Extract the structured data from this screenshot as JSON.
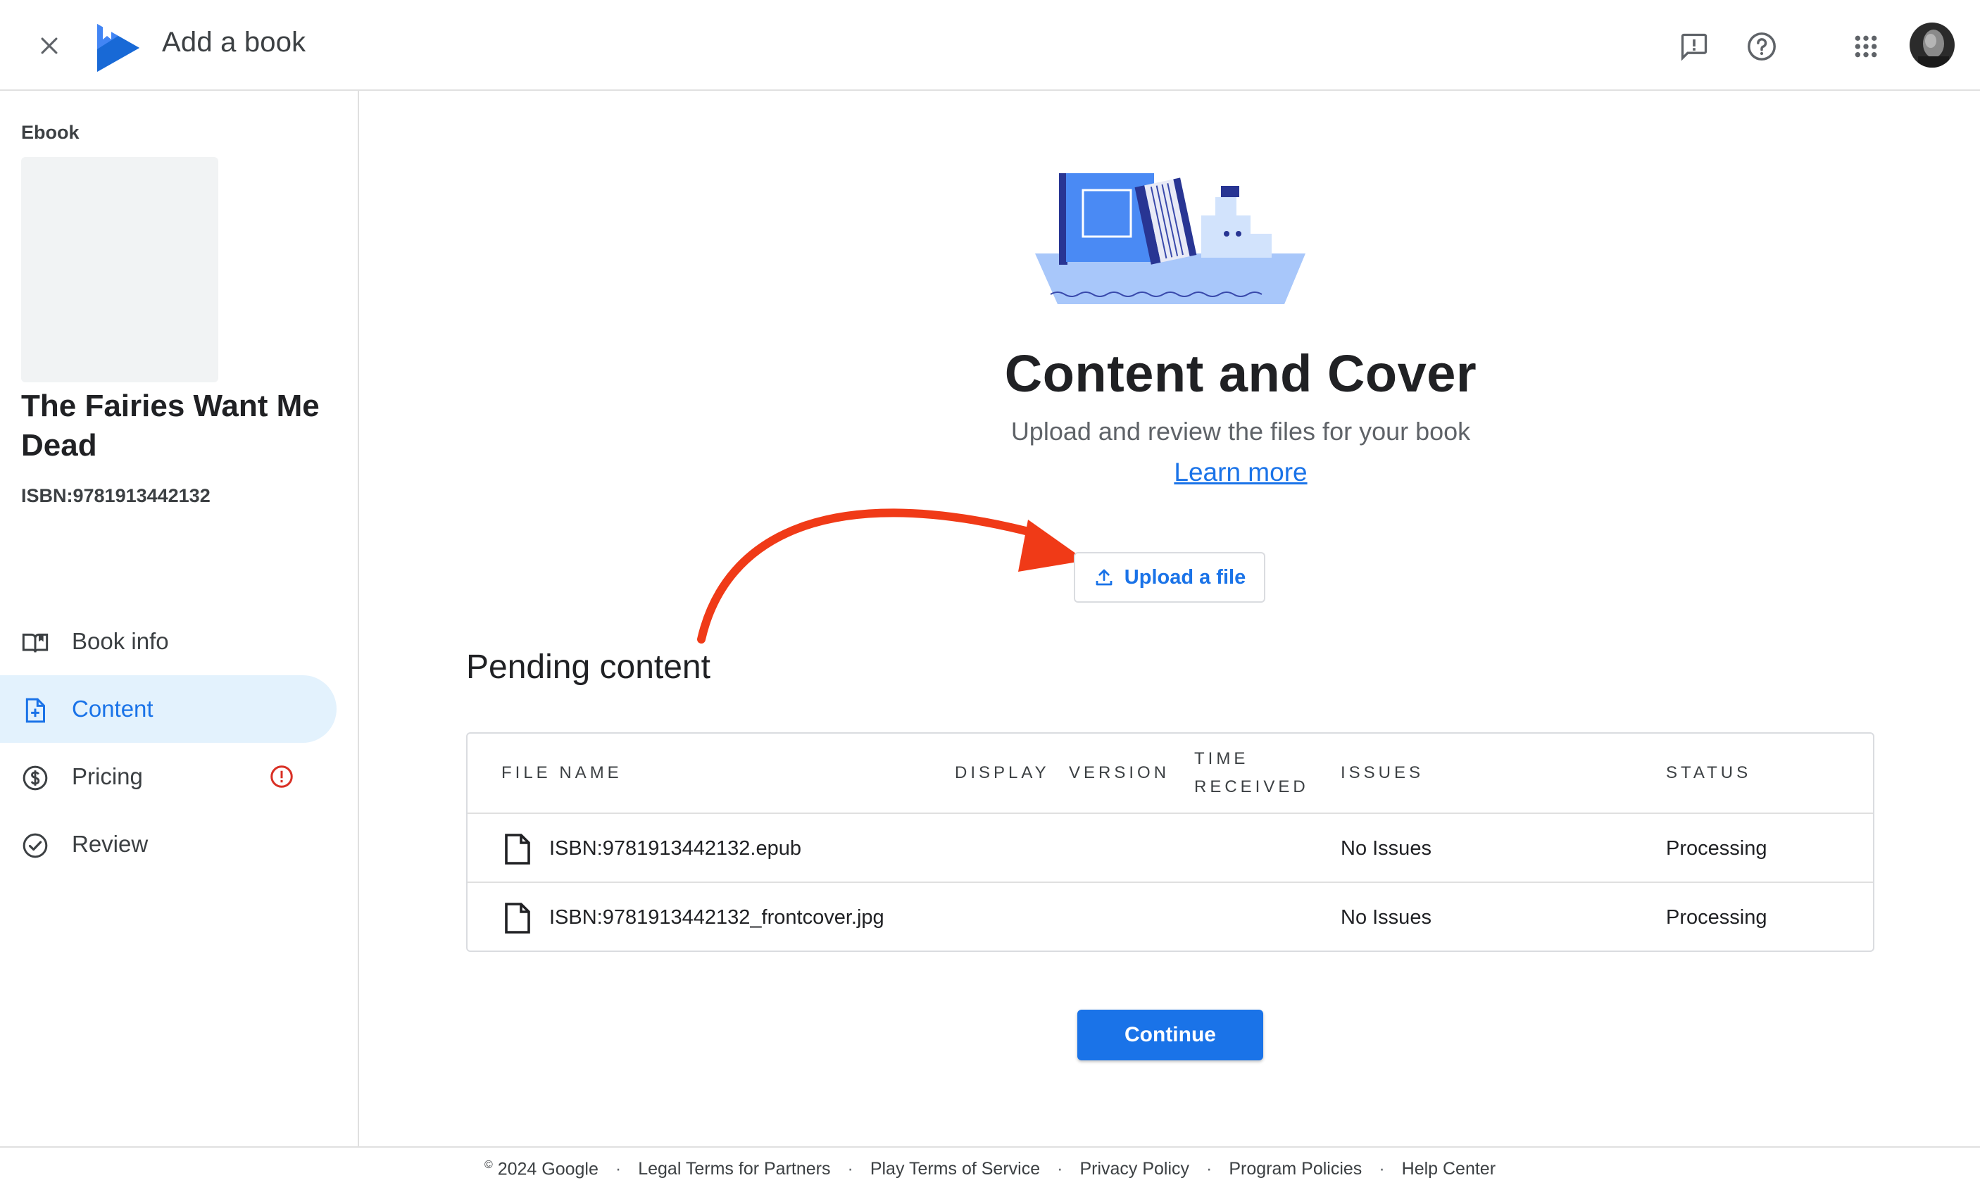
{
  "header": {
    "title": "Add a book",
    "icons": [
      "close-icon",
      "google-play-books-logo",
      "feedback-icon",
      "help-icon",
      "apps-grid-icon",
      "avatar"
    ]
  },
  "sidebar": {
    "section_label": "Ebook",
    "book_title": "The Fairies Want Me Dead",
    "isbn": "ISBN:9781913442132",
    "nav": [
      {
        "label": "Book info",
        "icon": "book-open-icon",
        "active": false
      },
      {
        "label": "Content",
        "icon": "file-add-icon",
        "active": true
      },
      {
        "label": "Pricing",
        "icon": "dollar-circle-icon",
        "active": false,
        "warning": true
      },
      {
        "label": "Review",
        "icon": "check-circle-icon",
        "active": false
      }
    ]
  },
  "main": {
    "title": "Content and Cover",
    "subtitle": "Upload and review the files for your book",
    "learn_more": "Learn more",
    "upload_label": "Upload a file",
    "pending_title": "Pending content",
    "table": {
      "headers": {
        "file_name": "FILE NAME",
        "display": "DISPLAY",
        "version": "VERSION",
        "time_received_1": "TIME",
        "time_received_2": "RECEIVED",
        "issues": "ISSUES",
        "status": "STATUS"
      },
      "rows": [
        {
          "file_name": "ISBN:9781913442132.epub",
          "display": "",
          "version": "",
          "time_received": "",
          "issues": "No Issues",
          "status": "Processing"
        },
        {
          "file_name": "ISBN:9781913442132_frontcover.jpg",
          "display": "",
          "version": "",
          "time_received": "",
          "issues": "No Issues",
          "status": "Processing"
        }
      ]
    },
    "continue_label": "Continue"
  },
  "footer": {
    "copyright_mark": "©",
    "copyright": "2024 Google",
    "separator": "·",
    "links": [
      "Legal Terms for Partners",
      "Play Terms of Service",
      "Privacy Policy",
      "Program Policies",
      "Help Center"
    ]
  },
  "colors": {
    "accent": "#1a73e8",
    "active_nav_bg": "#e3f2fd",
    "warning": "#d93025",
    "annotation_arrow": "#f03a17"
  }
}
